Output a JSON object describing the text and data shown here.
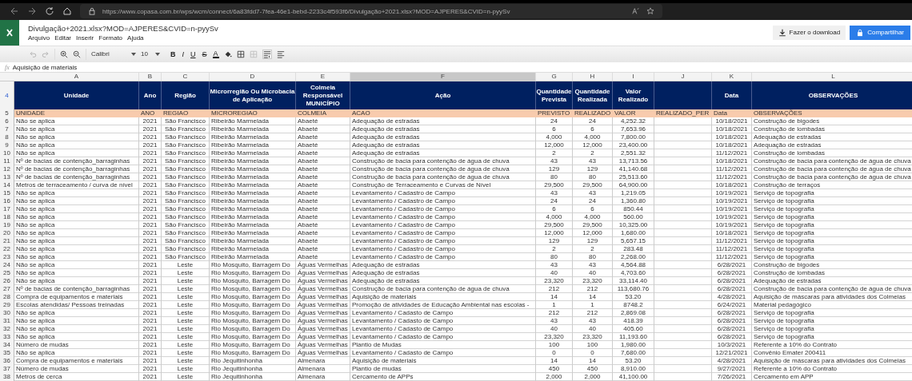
{
  "browser": {
    "address": "https://www.copasa.com.br/wps/wcm/connect/6a83fdd7-7fea-46e1-bebd-2233c4f593f6/Divulgação+2021.xlsx?MOD=AJPERES&CVID=n-pyySv"
  },
  "app": {
    "title": "Divulgação+2021.xlsx?MOD=AJPERES&CVID=n-pyySv",
    "menu": [
      "Arquivo",
      "Editar",
      "Inserir",
      "Formato",
      "Ajuda"
    ],
    "download_button": "Fazer o download",
    "share_button": "Compartilhar"
  },
  "toolbar": {
    "font": "Calibri",
    "size": "10",
    "format_buttons": [
      {
        "label": "B",
        "kind": "bold"
      },
      {
        "label": "I",
        "kind": "italic"
      },
      {
        "label": "U",
        "kind": "underline"
      },
      {
        "label": "S",
        "kind": "strike"
      },
      {
        "label": "A",
        "kind": "color"
      }
    ]
  },
  "formula_bar": {
    "label": "fx",
    "value": "Aquisição de materiais"
  },
  "sheet": {
    "header_row": "4",
    "code_row": "5",
    "columns": [
      {
        "letter": "A",
        "heading": "Unidade",
        "code": "UNIDADE",
        "selected": false
      },
      {
        "letter": "B",
        "heading": "Ano",
        "code": "ANO",
        "selected": false
      },
      {
        "letter": "C",
        "heading": "Região",
        "code": "REGIAO",
        "selected": false
      },
      {
        "letter": "D",
        "heading": "Microrregião Ou Microbacia de Aplicação",
        "code": "MICROREGIAO",
        "selected": false
      },
      {
        "letter": "E",
        "heading": "Colmeia Responsável MUNICÍPIO",
        "code": "COLMEIA",
        "selected": false
      },
      {
        "letter": "F",
        "heading": "Ação",
        "code": "ACAO",
        "selected": true
      },
      {
        "letter": "G",
        "heading": "Quantidade Prevista",
        "code": "PREVISTO",
        "selected": false
      },
      {
        "letter": "H",
        "heading": "Quantidade Realizada",
        "code": "REALIZADO",
        "selected": false
      },
      {
        "letter": "I",
        "heading": "Valor Realizado",
        "code": "VALOR",
        "selected": false
      },
      {
        "letter": "J",
        "code": "REALIZADO_PER",
        "selected": false
      },
      {
        "letter": "K",
        "heading": "Data",
        "code": "Data",
        "selected": false
      },
      {
        "letter": "L",
        "heading": "OBSERVAÇÕES",
        "code": "OBSERVAÇÕES",
        "selected": false
      }
    ],
    "rows": [
      {
        "number": "6",
        "cells": [
          "Não se aplica",
          "2021",
          "São Francisco",
          "Ribeirão Marmelada",
          "Abaeté",
          "Adequação de estradas",
          "24",
          "24",
          "4,252.32",
          "",
          "10/18/2021",
          "Construção de bigodes"
        ]
      },
      {
        "number": "7",
        "cells": [
          "Não se aplica",
          "2021",
          "São Francisco",
          "Ribeirão Marmelada",
          "Abaeté",
          "Adequação de estradas",
          "6",
          "6",
          "7,653.96",
          "",
          "10/18/2021",
          "Construção de lombadas"
        ]
      },
      {
        "number": "8",
        "cells": [
          "Não se aplica",
          "2021",
          "São Francisco",
          "Ribeirão Marmelada",
          "Abaeté",
          "Adequação de estradas",
          "4,000",
          "4,000",
          "7,800.00",
          "",
          "10/18/2021",
          "Adequação de estradas"
        ]
      },
      {
        "number": "9",
        "cells": [
          "Não se aplica",
          "2021",
          "São Francisco",
          "Ribeirão Marmelada",
          "Abaeté",
          "Adequação de estradas",
          "12,000",
          "12,000",
          "23,400.00",
          "",
          "10/18/2021",
          "Adequação de estradas"
        ]
      },
      {
        "number": "10",
        "cells": [
          "Não se aplica",
          "2021",
          "São Francisco",
          "Ribeirão Marmelada",
          "Abaeté",
          "Adequação de estradas",
          "2",
          "2",
          "2,551.32",
          "",
          "11/12/2021",
          "Construção de lombadas"
        ]
      },
      {
        "number": "11",
        "cells": [
          "Nº de bacias de contenção_barraginhas",
          "2021",
          "São Francisco",
          "Ribeirão Marmelada",
          "Abaeté",
          "Construção de bacia para contenção de água de chuva",
          "43",
          "43",
          "13,713.56",
          "",
          "10/18/2021",
          "Construção de bacia para contenção de água de chuva"
        ]
      },
      {
        "number": "12",
        "cells": [
          "Nº de bacias de contenção_barraginhas",
          "2021",
          "São Francisco",
          "Ribeirão Marmelada",
          "Abaeté",
          "Construção de bacia para contenção de água de chuva",
          "129",
          "129",
          "41,140.68",
          "",
          "11/12/2021",
          "Construção de bacia para contenção de água de chuva"
        ]
      },
      {
        "number": "13",
        "cells": [
          "Nº de bacias de contenção_barraginhas",
          "2021",
          "São Francisco",
          "Ribeirão Marmelada",
          "Abaeté",
          "Construção de bacia para contenção de água de chuva",
          "80",
          "80",
          "25,513.60",
          "",
          "11/12/2021",
          "Construção de bacia para contenção de água de chuva"
        ]
      },
      {
        "number": "14",
        "cells": [
          "Metros de terraceamento / curva de nível",
          "2021",
          "São Francisco",
          "Ribeirão Marmelada",
          "Abaeté",
          "Construção de Terraceamento e Curvas de Nível",
          "29,500",
          "29,500",
          "64,900.00",
          "",
          "10/18/2021",
          "Construção de terraços"
        ]
      },
      {
        "number": "15",
        "cells": [
          "Não se aplica",
          "2021",
          "São Francisco",
          "Ribeirão Marmelada",
          "Abaeté",
          "Levantamento / Cadastro de Campo",
          "43",
          "43",
          "1,219.05",
          "",
          "10/19/2021",
          "Serviço de topografia"
        ]
      },
      {
        "number": "16",
        "cells": [
          "Não se aplica",
          "2021",
          "São Francisco",
          "Ribeirão Marmelada",
          "Abaeté",
          "Levantamento / Cadastro de Campo",
          "24",
          "24",
          "1,360.80",
          "",
          "10/19/2021",
          "Serviço de topografia"
        ]
      },
      {
        "number": "17",
        "cells": [
          "Não se aplica",
          "2021",
          "São Francisco",
          "Ribeirão Marmelada",
          "Abaeté",
          "Levantamento / Cadastro de Campo",
          "6",
          "6",
          "850.44",
          "",
          "10/19/2021",
          "Serviço de topografia"
        ]
      },
      {
        "number": "18",
        "cells": [
          "Não se aplica",
          "2021",
          "São Francisco",
          "Ribeirão Marmelada",
          "Abaeté",
          "Levantamento / Cadastro de Campo",
          "4,000",
          "4,000",
          "560.00",
          "",
          "10/19/2021",
          "Serviço de topografia"
        ]
      },
      {
        "number": "19",
        "cells": [
          "Não se aplica",
          "2021",
          "São Francisco",
          "Ribeirão Marmelada",
          "Abaeté",
          "Levantamento / Cadastro de Campo",
          "29,500",
          "29,500",
          "10,325.00",
          "",
          "10/19/2021",
          "Serviço de topografia"
        ]
      },
      {
        "number": "20",
        "cells": [
          "Não se aplica",
          "2021",
          "São Francisco",
          "Ribeirão Marmelada",
          "Abaeté",
          "Levantamento / Cadastro de Campo",
          "12,000",
          "12,000",
          "1,680.00",
          "",
          "10/18/2021",
          "Serviço de topografia"
        ]
      },
      {
        "number": "21",
        "cells": [
          "Não se aplica",
          "2021",
          "São Francisco",
          "Ribeirão Marmelada",
          "Abaeté",
          "Levantamento / Cadastro de Campo",
          "129",
          "129",
          "5,657.15",
          "",
          "11/12/2021",
          "Serviço de topografia"
        ]
      },
      {
        "number": "22",
        "cells": [
          "Não se aplica",
          "2021",
          "São Francisco",
          "Ribeirão Marmelada",
          "Abaeté",
          "Levantamento / Cadastro de Campo",
          "2",
          "2",
          "283.48",
          "",
          "11/12/2021",
          "Serviço de topografia"
        ]
      },
      {
        "number": "23",
        "cells": [
          "Não se aplica",
          "2021",
          "São Francisco",
          "Ribeirão Marmelada",
          "Abaeté",
          "Levantamento / Cadastro de Campo",
          "80",
          "80",
          "2,268.00",
          "",
          "11/12/2021",
          "Serviço de topografia"
        ]
      },
      {
        "number": "24",
        "cells": [
          "Não se aplica",
          "2021",
          "Leste",
          "Rio Mosquito, Barragem Do",
          "Águas Vermelhas",
          "Adequação de estradas",
          "43",
          "43",
          "4,564.88",
          "",
          "6/28/2021",
          "Construção de bigodes"
        ]
      },
      {
        "number": "25",
        "cells": [
          "Não se aplica",
          "2021",
          "Leste",
          "Rio Mosquito, Barragem Do",
          "Águas Vermelhas",
          "Adequação de estradas",
          "40",
          "40",
          "4,703.60",
          "",
          "6/28/2021",
          "Construção de lombadas"
        ]
      },
      {
        "number": "26",
        "cells": [
          "Não se aplica",
          "2021",
          "Leste",
          "Rio Mosquito, Barragem Do",
          "Águas Vermelhas",
          "Adequação de estradas",
          "23,320",
          "23,320",
          "33,114.40",
          "",
          "6/28/2021",
          "Adequação de estradas"
        ]
      },
      {
        "number": "27",
        "cells": [
          "Nº de bacias de contenção_barraginhas",
          "2021",
          "Leste",
          "Rio Mosquito, Barragem Do",
          "Águas Vermelhas",
          "Construção de bacia para contenção de água de chuva",
          "212",
          "212",
          "113,680.76",
          "",
          "6/28/2021",
          "Construção de bacia para contenção de água de chuva"
        ]
      },
      {
        "number": "28",
        "cells": [
          "Compra de equipamentos e materiais",
          "2021",
          "Leste",
          "Rio Mosquito, Barragem Do",
          "Águas Vermelhas",
          "Aquisição de materiais",
          "14",
          "14",
          "53.20",
          "",
          "4/28/2021",
          "Aquisição de máscaras para atividades dos Colmeias"
        ]
      },
      {
        "number": "29",
        "cells": [
          "Escolas atendidas/ Pessoas treinadas",
          "2021",
          "Leste",
          "Rio Mosquito, Barragem Do",
          "Águas Vermelhas",
          "Promoção de atividades de Educação Ambiental nas escolas -",
          "1",
          "1",
          "8748.2",
          "",
          "6/24/2021",
          "Material pedagógico"
        ]
      },
      {
        "number": "30",
        "cells": [
          "Não se aplica",
          "2021",
          "Leste",
          "Rio Mosquito, Barragem Do",
          "Águas Vermelhas",
          "Levantamento / Cadasto de Campo",
          "212",
          "212",
          "2,869.08",
          "",
          "6/28/2021",
          "Serviço de topografia"
        ]
      },
      {
        "number": "31",
        "cells": [
          "Não se aplica",
          "2021",
          "Leste",
          "Rio Mosquito, Barragem Do",
          "Águas Vermelhas",
          "Levantamento / Cadasto de Campo",
          "43",
          "43",
          "418.39",
          "",
          "6/28/2021",
          "Serviço de topografia"
        ]
      },
      {
        "number": "32",
        "cells": [
          "Não se aplica",
          "2021",
          "Leste",
          "Rio Mosquito, Barragem Do",
          "Águas Vermelhas",
          "Levantamento / Cadasto de Campo",
          "40",
          "40",
          "405.60",
          "",
          "6/28/2021",
          "Serviço de topografia"
        ]
      },
      {
        "number": "33",
        "cells": [
          "Não se aplica",
          "2021",
          "Leste",
          "Rio Mosquito, Barragem Do",
          "Águas Vermelhas",
          "Levantamento / Cadasto de Campo",
          "23,320",
          "23,320",
          "11,193.60",
          "",
          "6/28/2021",
          "Serviço de topografia"
        ]
      },
      {
        "number": "34",
        "cells": [
          "Número de mudas",
          "2021",
          "Leste",
          "Rio Mosquito, Barragem Do",
          "Águas Vermelhas",
          "Plantio de Mudas",
          "100",
          "100",
          "1,980.00",
          "",
          "10/3/2021",
          "Referente a 10% do Contrato"
        ]
      },
      {
        "number": "35",
        "cells": [
          "Não se aplica",
          "2021",
          "Leste",
          "Rio Mosquito, Barragem Do",
          "Águas Vermelhas",
          "Levantamento / Cadasto de Campo",
          "0",
          "0",
          "7,680.00",
          "",
          "12/21/2021",
          "Convênio Emater 200411"
        ]
      },
      {
        "number": "36",
        "cells": [
          "Compra de equipamentos e materiais",
          "2021",
          "Leste",
          "Rio Jequitinhonha",
          "Almenara",
          "Aquisição de materiais",
          "14",
          "14",
          "53.20",
          "",
          "4/28/2021",
          "Aquisição de máscaras para atividades dos Colmeias"
        ]
      },
      {
        "number": "37",
        "cells": [
          "Número de mudas",
          "2021",
          "Leste",
          "Rio Jequitinhonha",
          "Almenara",
          "Plantio de mudas",
          "450",
          "450",
          "8,910.00",
          "",
          "9/27/2021",
          "Referente a 10% do Contrato"
        ]
      },
      {
        "number": "38",
        "cells": [
          "Metros de cerca",
          "2021",
          "Leste",
          "Rio Jequitinhonha",
          "Almenara",
          "Cercamento de APPs",
          "2,000",
          "2,000",
          "41,100.00",
          "",
          "7/26/2021",
          "Cercamento em APP"
        ]
      }
    ]
  }
}
